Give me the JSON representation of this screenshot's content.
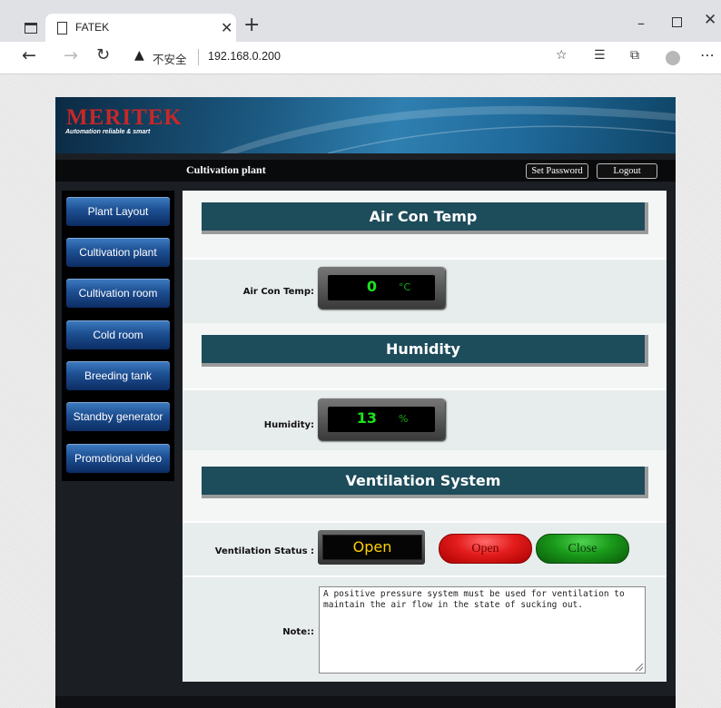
{
  "browser": {
    "tab_title": "FATEK",
    "security_label": "不安全",
    "url": "192.168.0.200",
    "icons": [
      "window-icon",
      "page-icon",
      "close-icon",
      "new-tab-icon",
      "minimize-icon",
      "maximize-icon",
      "close-window-icon",
      "back-icon",
      "forward-icon",
      "refresh-icon",
      "warning-icon",
      "add-favorite-icon",
      "favorites-icon",
      "collections-icon",
      "profile-icon",
      "more-icon"
    ]
  },
  "header": {
    "logo_text": "MERITEK",
    "logo_tagline": "Automation reliable & smart",
    "page_title": "Cultivation plant",
    "set_password_label": "Set Password",
    "logout_label": "Logout"
  },
  "sidebar": {
    "items": [
      {
        "label": "Plant Layout"
      },
      {
        "label": "Cultivation plant"
      },
      {
        "label": "Cultivation room"
      },
      {
        "label": "Cold room"
      },
      {
        "label": "Breeding tank"
      },
      {
        "label": "Standby generator"
      },
      {
        "label": "Promotional video"
      }
    ]
  },
  "main": {
    "aircon": {
      "section_title": "Air Con Temp",
      "label": "Air Con Temp:",
      "value": "0",
      "unit": "°C"
    },
    "humidity": {
      "section_title": "Humidity",
      "label": "Humidity:",
      "value": "13",
      "unit": "%"
    },
    "ventilation": {
      "section_title": "Ventilation System",
      "status_label": "Ventilation Status :",
      "status_value": "Open",
      "open_button": "Open",
      "close_button": "Close"
    },
    "note": {
      "label": "Note::",
      "text": "A positive pressure system must be used for ventilation to maintain the air flow in the state of sucking out."
    }
  },
  "colors": {
    "section_header": "#1d4c5b",
    "lcd_digits": "#1be31b",
    "status_text": "#ffd000",
    "open_button": "#e31c1c",
    "close_button": "#1a9a1a",
    "logo": "#c62828",
    "nav_button": "#1d4f92"
  }
}
